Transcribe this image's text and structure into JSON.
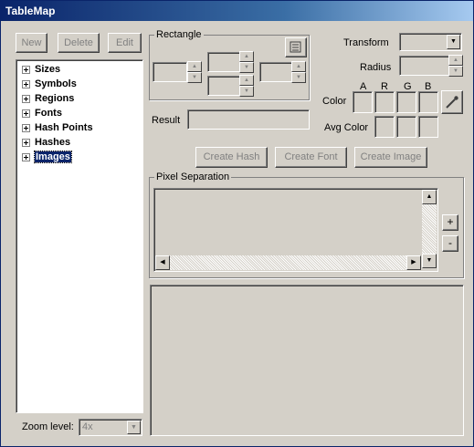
{
  "window": {
    "title": "TableMap"
  },
  "toolbar": {
    "new_label": "New",
    "delete_label": "Delete",
    "edit_label": "Edit"
  },
  "tree": {
    "items": [
      {
        "label": "Sizes"
      },
      {
        "label": "Symbols"
      },
      {
        "label": "Regions"
      },
      {
        "label": "Fonts"
      },
      {
        "label": "Hash Points"
      },
      {
        "label": "Hashes"
      },
      {
        "label": "Images"
      }
    ],
    "selected": "Images"
  },
  "zoom": {
    "label": "Zoom level:",
    "value": "4x"
  },
  "rectangle": {
    "label": "Rectangle"
  },
  "result": {
    "label": "Result",
    "value": ""
  },
  "transform": {
    "label": "Transform",
    "value": ""
  },
  "radius": {
    "label": "Radius",
    "value": ""
  },
  "color": {
    "label": "Color",
    "avg_label": "Avg Color",
    "channels": {
      "a": "A",
      "r": "R",
      "g": "G",
      "b": "B"
    }
  },
  "actions": {
    "create_hash": "Create Hash",
    "create_font": "Create Font",
    "create_image": "Create Image"
  },
  "pixel_separation": {
    "label": "Pixel Separation",
    "add": "+",
    "remove": "-"
  },
  "icons": {
    "picker": "eyedropper-icon",
    "rect_grab": "rectangle-capture-icon"
  }
}
